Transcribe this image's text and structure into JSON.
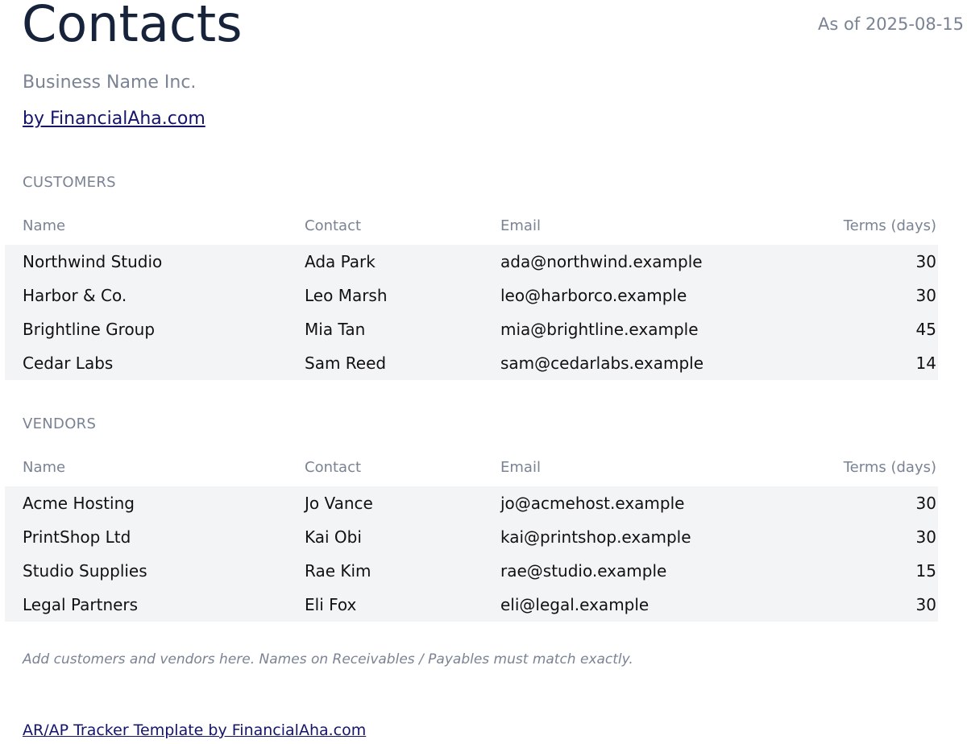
{
  "header": {
    "title": "Contacts",
    "as_of": "As of 2025-08-15",
    "business_name": "Business Name Inc.",
    "byline": "by FinancialAha.com"
  },
  "customers": {
    "label": "CUSTOMERS",
    "columns": [
      "Name",
      "Contact",
      "Email",
      "Terms (days)"
    ],
    "rows": [
      {
        "name": "Northwind Studio",
        "contact": "Ada Park",
        "email": "ada@northwind.example",
        "terms": "30"
      },
      {
        "name": "Harbor & Co.",
        "contact": "Leo Marsh",
        "email": "leo@harborco.example",
        "terms": "30"
      },
      {
        "name": "Brightline Group",
        "contact": "Mia Tan",
        "email": "mia@brightline.example",
        "terms": "45"
      },
      {
        "name": "Cedar Labs",
        "contact": "Sam Reed",
        "email": "sam@cedarlabs.example",
        "terms": "14"
      }
    ]
  },
  "vendors": {
    "label": "VENDORS",
    "columns": [
      "Name",
      "Contact",
      "Email",
      "Terms (days)"
    ],
    "rows": [
      {
        "name": "Acme Hosting",
        "contact": "Jo Vance",
        "email": "jo@acmehost.example",
        "terms": "30"
      },
      {
        "name": "PrintShop Ltd",
        "contact": "Kai Obi",
        "email": "kai@printshop.example",
        "terms": "30"
      },
      {
        "name": "Studio Supplies",
        "contact": "Rae Kim",
        "email": "rae@studio.example",
        "terms": "15"
      },
      {
        "name": "Legal Partners",
        "contact": "Eli Fox",
        "email": "eli@legal.example",
        "terms": "30"
      }
    ]
  },
  "note": "Add customers and vendors here. Names on Receivables / Payables must match exactly.",
  "footer": {
    "link": "AR/AP Tracker Template by FinancialAha.com"
  },
  "colors": {
    "title": "#16233b",
    "muted": "#7a8394",
    "link": "#14146b",
    "row_band": "#f3f4f6"
  }
}
